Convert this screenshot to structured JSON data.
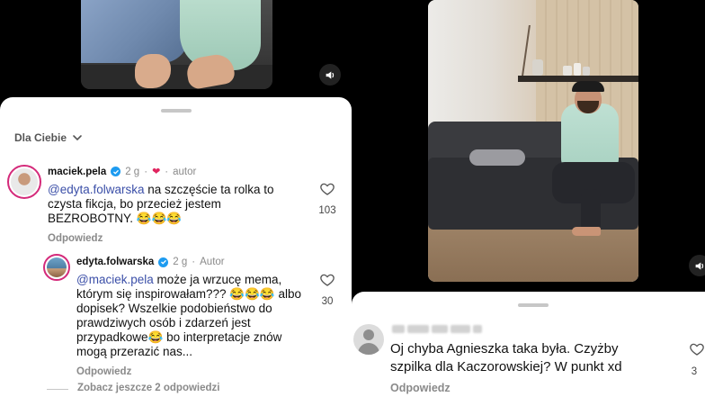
{
  "left": {
    "sort_label": "Dla Ciebie",
    "comment1": {
      "username": "maciek.pela",
      "age": "2 g",
      "author_label": "autor",
      "author_separator": "·",
      "mention": "@edyta.folwarska",
      "text": " na szczęście ta rolka to czysta fikcja, bo przecież jestem BEZROBOTNY. 😂😂😂",
      "likes": "103",
      "reply_label": "Odpowiedz"
    },
    "comment2": {
      "username": "edyta.folwarska",
      "age": "2 g",
      "author_label": "Autor",
      "author_separator": "·",
      "mention": "@maciek.pela",
      "text": " może ja wrzucę mema, którym się inspirowałam??? 😂😂😂 albo dopisek? Wszelkie podobieństwo do prawdziwych osób i zdarzeń jest przypadkowe😂 bo interpretacje znów mogą przerazić nas...",
      "likes": "30",
      "reply_label": "Odpowiedz"
    },
    "more_replies": "Zobacz jeszcze 2 odpowiedzi"
  },
  "right": {
    "comment": {
      "text": "Oj chyba Agnieszka taka była. Czyżby szpilka dla Kaczorowskiej? W punkt xd",
      "likes": "3",
      "reply_label": "Odpowiedz"
    }
  },
  "colors": {
    "mention": "#3b4fa8",
    "verified": "#1d9bf0",
    "heart": "#e0245e",
    "story_ring": "#d42a7a"
  }
}
